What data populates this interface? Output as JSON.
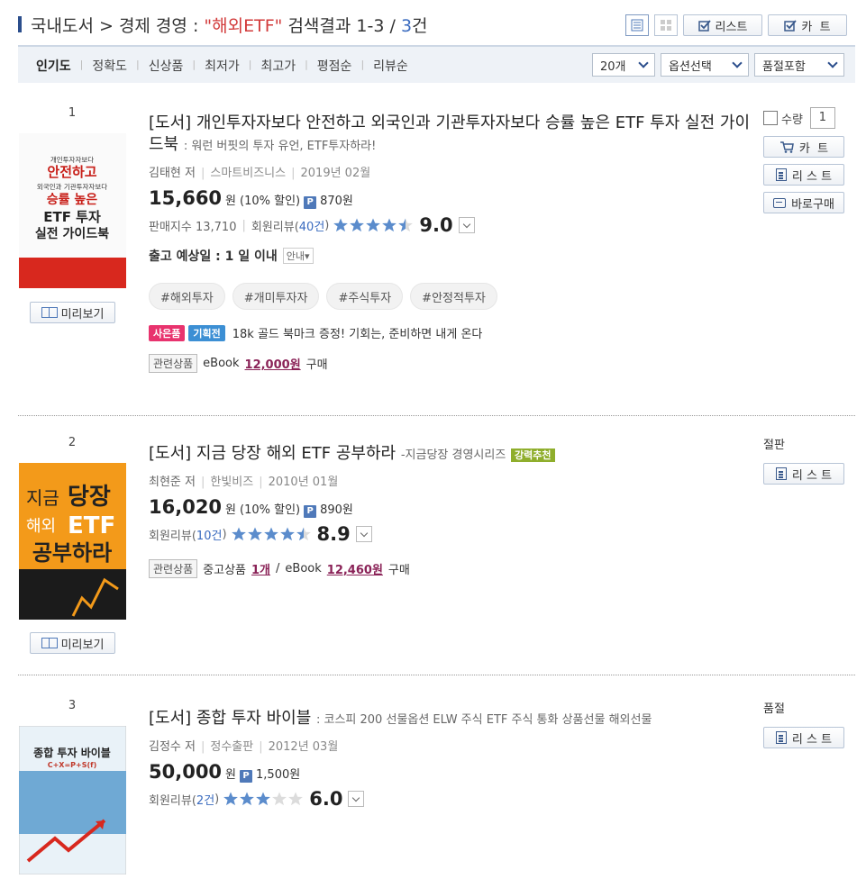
{
  "header": {
    "category": "국내도서",
    "arrow": ">",
    "subcategory": "경제 경영",
    "colon": ":",
    "keyword": "\"해외ETF\"",
    "result_label": "검색결과",
    "range": "1-3",
    "slash": "/",
    "total": "3",
    "unit": "건",
    "list_btn": "리스트",
    "cart_btn": "카  트"
  },
  "sort": {
    "items": [
      "인기도",
      "정확도",
      "신상품",
      "최저가",
      "최고가",
      "평점순",
      "리뷰순"
    ],
    "per_page": "20개",
    "option": "옵션선택",
    "soldout": "품절포함"
  },
  "results": [
    {
      "rank": "1",
      "title": "[도서] 개인투자자보다 안전하고 외국인과 기관투자자보다 승률 높은 ETF 투자 실전 가이드북",
      "subtitle": ": 워런 버핏의 투자 유언, ETF투자하라!",
      "author": "김태현 저",
      "publisher": "스마트비즈니스",
      "date": "2019년 02월",
      "price": "15,660",
      "price_unit": "원",
      "discount": "(10% 할인)",
      "point_badge": "P",
      "points": "870원",
      "sales_index": "판매지수 13,710",
      "review_label": "회원리뷰(",
      "review_count": "40건",
      "review_close": ")",
      "rating": 4.5,
      "score": "9.0",
      "ship_text": "출고 예상일 : 1 일 이내",
      "ship_guide": "안내▾",
      "tags": [
        "#해외투자",
        "#개미투자자",
        "#주식투자",
        "#안정적투자"
      ],
      "badge_gift": "사은품",
      "badge_plan": "기획전",
      "promo_text": "18k 골드 북마크 증정! 기회는, 준비하면 내게 온다",
      "related_badge": "관련상품",
      "related_prefix": "eBook",
      "related_price": "12,000원",
      "related_suffix": "구매",
      "qty_label": "수량",
      "qty_value": "1",
      "cart_btn": "카  트",
      "list_btn": "리 스 트",
      "buy_btn": "바로구매",
      "preview_btn": "미리보기",
      "cover_title1": "개인투자자보다",
      "cover_title2": "안전하고",
      "cover_title3": "외국인과 기관투자자보다",
      "cover_title4": "승률 높은",
      "cover_title5": "ETF 투자",
      "cover_title6": "실전 가이드북"
    },
    {
      "rank": "2",
      "title": "[도서] 지금 당장 해외 ETF 공부하라",
      "series": "-지금당장 경영시리즈",
      "recommend": "강력추천",
      "author": "최현준 저",
      "publisher": "한빛비즈",
      "date": "2010년 01월",
      "price": "16,020",
      "price_unit": "원",
      "discount": "(10% 할인)",
      "point_badge": "P",
      "points": "890원",
      "review_label": "회원리뷰(",
      "review_count": "10건",
      "review_close": ")",
      "rating": 4.5,
      "score": "8.9",
      "related_badge": "관련상품",
      "used_label": "중고상품",
      "used_count": "1개",
      "related_sep": "/",
      "related_prefix": "eBook",
      "related_price": "12,460원",
      "related_suffix": "구매",
      "status": "절판",
      "list_btn": "리 스 트",
      "preview_btn": "미리보기",
      "cover_line1": "지금",
      "cover_line2": "당장",
      "cover_line3": "해외",
      "cover_line4": "ETF",
      "cover_line5": "공부하라"
    },
    {
      "rank": "3",
      "title": "[도서] 종합 투자 바이블",
      "subtitle": ": 코스피 200 선물옵션 ELW 주식 ETF 주식 통화 상품선물 해외선물",
      "author": "김정수 저",
      "publisher": "정수출판",
      "date": "2012년 03월",
      "price": "50,000",
      "price_unit": "원",
      "point_badge": "P",
      "points": "1,500원",
      "review_label": "회원리뷰(",
      "review_count": "2건",
      "review_close": ")",
      "rating": 3,
      "score": "6.0",
      "status": "품절",
      "list_btn": "리 스 트",
      "cover_title": "종합 투자 바이블",
      "cover_formula": "C+X=P+S(f)"
    }
  ],
  "colors": {
    "accent": "#2b4e8c",
    "keyword": "#d23a3a",
    "star": "#5b8ccc",
    "related_price": "#8a2257"
  }
}
